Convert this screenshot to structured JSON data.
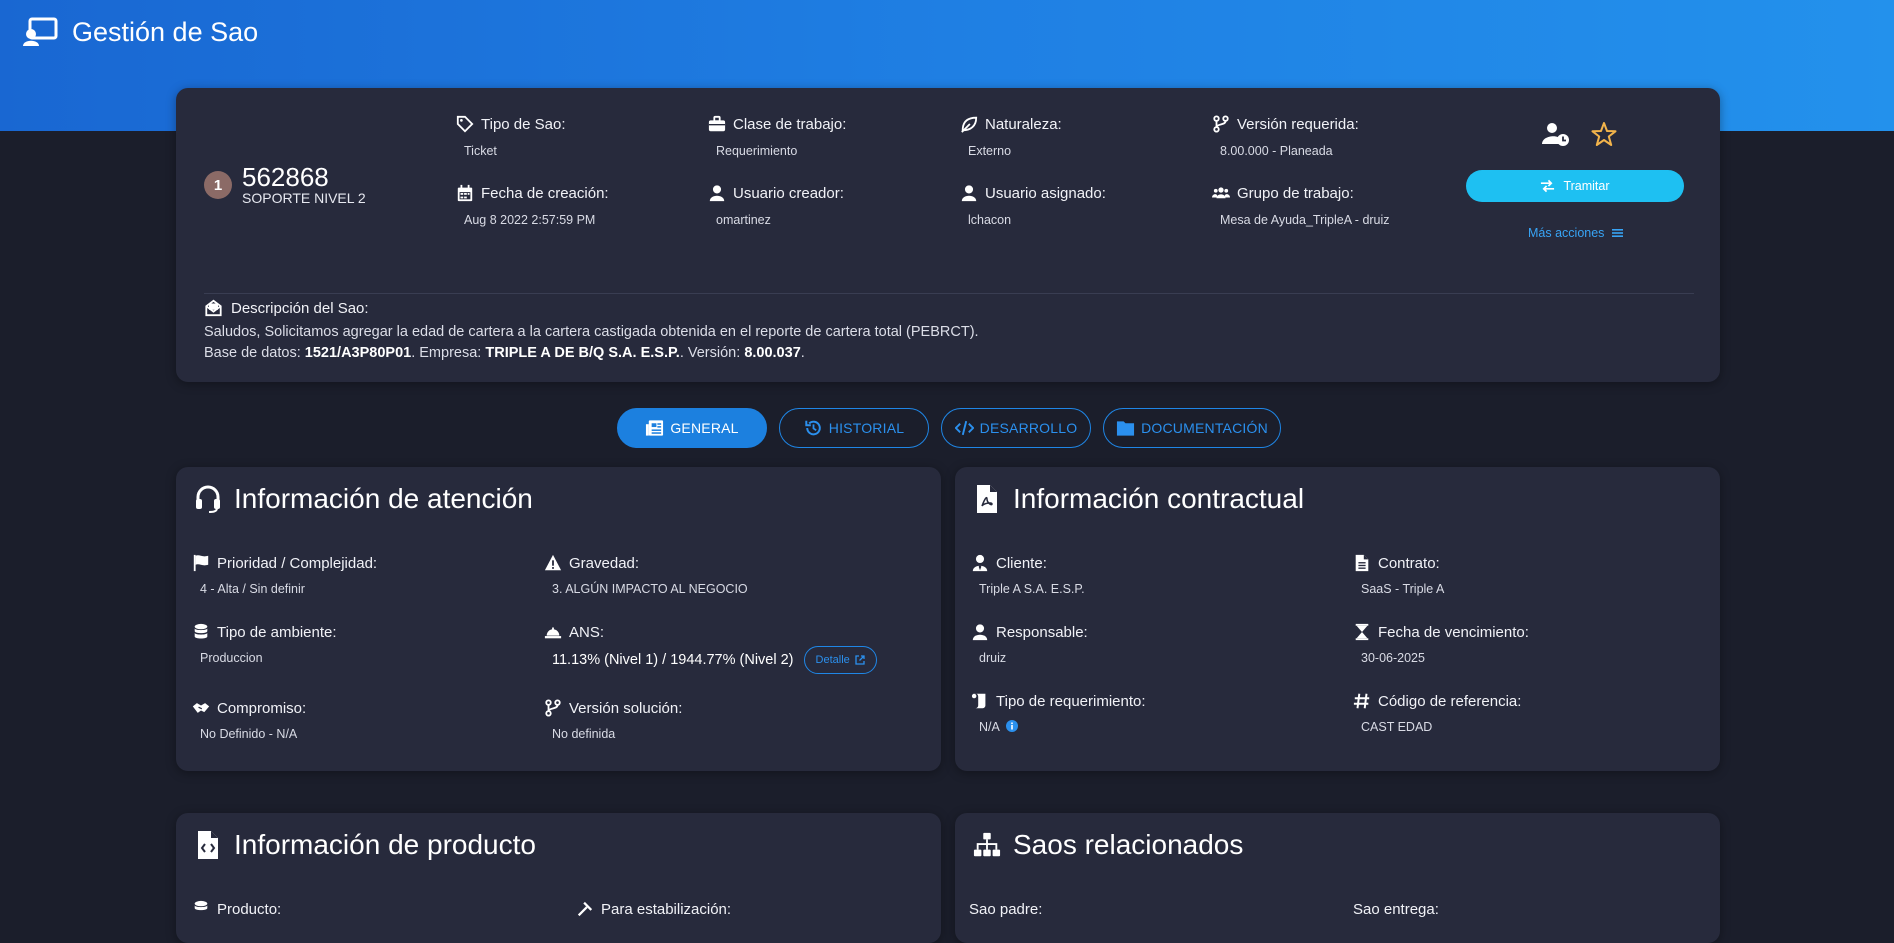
{
  "app": {
    "title": "Gestión de Sao"
  },
  "sao": {
    "badge": "1",
    "number": "562868",
    "level": "SOPORTE NIVEL 2",
    "fields": {
      "tipo": {
        "label": "Tipo de Sao:",
        "value": "Ticket"
      },
      "clase": {
        "label": "Clase de trabajo:",
        "value": "Requerimiento"
      },
      "naturaleza": {
        "label": "Naturaleza:",
        "value": "Externo"
      },
      "version": {
        "label": "Versión requerida:",
        "value": "8.00.000 - Planeada"
      },
      "fecha": {
        "label": "Fecha de creación:",
        "value": "Aug 8 2022 2:57:59 PM"
      },
      "creador": {
        "label": "Usuario creador:",
        "value": "omartinez"
      },
      "asignado": {
        "label": "Usuario asignado:",
        "value": "lchacon"
      },
      "grupo": {
        "label": "Grupo de trabajo:",
        "value": "Mesa de Ayuda_TripleA - druiz"
      }
    },
    "actions": {
      "tramitar": "Tramitar",
      "mas_acciones": "Más acciones"
    },
    "description": {
      "title": "Descripción del Sao:",
      "text": "Saludos, Solicitamos agregar la edad de cartera a la cartera castigada obtenida en el reporte de cartera total (PEBRCT).",
      "db_label": "Base de datos:",
      "db_value": "1521/A3P80P01",
      "company_label": "Empresa:",
      "company_value": "TRIPLE A DE B/Q S.A. E.S.P.",
      "version_label": "Versión:",
      "version_value": "8.00.037",
      "sep": ".",
      "space": " "
    }
  },
  "tabs": [
    "GENERAL",
    "HISTORIAL",
    "DESARROLLO",
    "DOCUMENTACIÓN"
  ],
  "atencion": {
    "title": "Información de atención",
    "prioridad": {
      "label": "Prioridad / Complejidad:",
      "value": "4 - Alta / Sin definir"
    },
    "gravedad": {
      "label": "Gravedad:",
      "value": "3. ALGÚN IMPACTO AL NEGOCIO"
    },
    "ambiente": {
      "label": "Tipo de ambiente:",
      "value": "Produccion"
    },
    "ans": {
      "label": "ANS:",
      "value": "11.13% (Nivel 1) / 1944.77% (Nivel 2)",
      "button": "Detalle"
    },
    "compromiso": {
      "label": "Compromiso:",
      "value": "No Definido - N/A"
    },
    "version_solucion": {
      "label": "Versión solución:",
      "value": "No definida"
    }
  },
  "contractual": {
    "title": "Información contractual",
    "cliente": {
      "label": "Cliente:",
      "value": "Triple A S.A. E.S.P."
    },
    "contrato": {
      "label": "Contrato:",
      "value": "SaaS - Triple A"
    },
    "responsable": {
      "label": "Responsable:",
      "value": "druiz"
    },
    "vencimiento": {
      "label": "Fecha de vencimiento:",
      "value": "30-06-2025"
    },
    "requerimiento": {
      "label": "Tipo de requerimiento:",
      "value": "N/A"
    },
    "referencia": {
      "label": "Código de referencia:",
      "value": "CAST EDAD"
    }
  },
  "producto": {
    "title": "Información de producto",
    "producto_label": "Producto:",
    "estabilizacion_label": "Para estabilización:"
  },
  "relacionados": {
    "title": "Saos relacionados",
    "padre_label": "Sao padre:",
    "entrega_label": "Sao entrega:"
  },
  "colors": {
    "accent": "#1c80df",
    "button": "#1ec0f2",
    "card": "#272a3c",
    "background": "#1b1e2b",
    "badge": "#8b6a66"
  },
  "icons": [
    "monitor-user-icon",
    "tag-icon",
    "briefcase-icon",
    "leaf-icon",
    "branch-icon",
    "calendar-icon",
    "user-icon",
    "users-icon",
    "user-clock-icon",
    "star-icon",
    "exchange-icon",
    "bars-icon",
    "envelope-open-icon",
    "newspaper-icon",
    "history-icon",
    "code-icon",
    "folder-icon",
    "headset-icon",
    "file-pdf-icon",
    "flag-icon",
    "warning-icon",
    "database-icon",
    "bell-icon",
    "handshake-icon",
    "user-tie-icon",
    "file-icon",
    "hourglass-icon",
    "scroll-icon",
    "hash-icon",
    "info-icon",
    "file-code-icon",
    "sitemap-icon",
    "external-link-icon"
  ]
}
